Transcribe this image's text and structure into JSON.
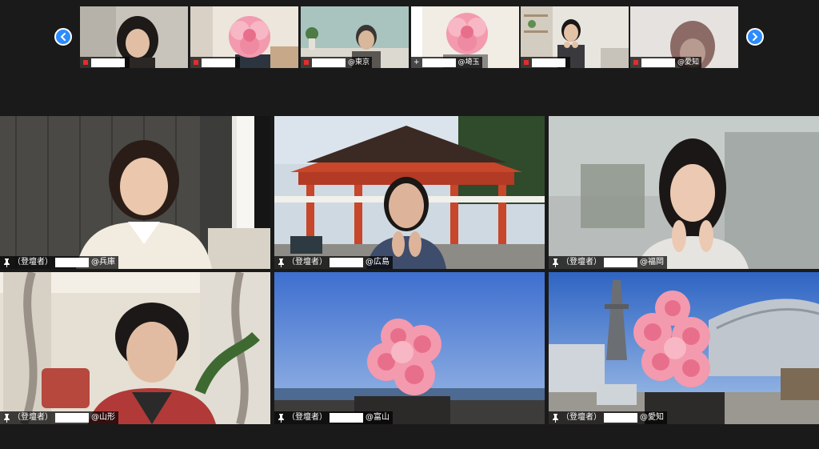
{
  "navigation": {
    "prev_icon": "chevron-left-icon",
    "next_icon": "chevron-right-icon",
    "accent": "#2d8cff"
  },
  "thumbnails": [
    {
      "suffix": ""
    },
    {
      "suffix": ""
    },
    {
      "suffix": "@東京"
    },
    {
      "suffix": "@埼玉",
      "prefix": "+"
    },
    {
      "suffix": ""
    },
    {
      "suffix": "@愛知"
    }
  ],
  "tiles": [
    {
      "role": "（登壇者）",
      "suffix": "@兵庫"
    },
    {
      "role": "（登壇者）",
      "suffix": "@広島"
    },
    {
      "role": "（登壇者）",
      "suffix": "@福岡"
    },
    {
      "role": "（登壇者）",
      "suffix": "@山形"
    },
    {
      "role": "（登壇者）",
      "suffix": "@富山"
    },
    {
      "role": "（登壇者）",
      "suffix": "@愛知"
    }
  ]
}
